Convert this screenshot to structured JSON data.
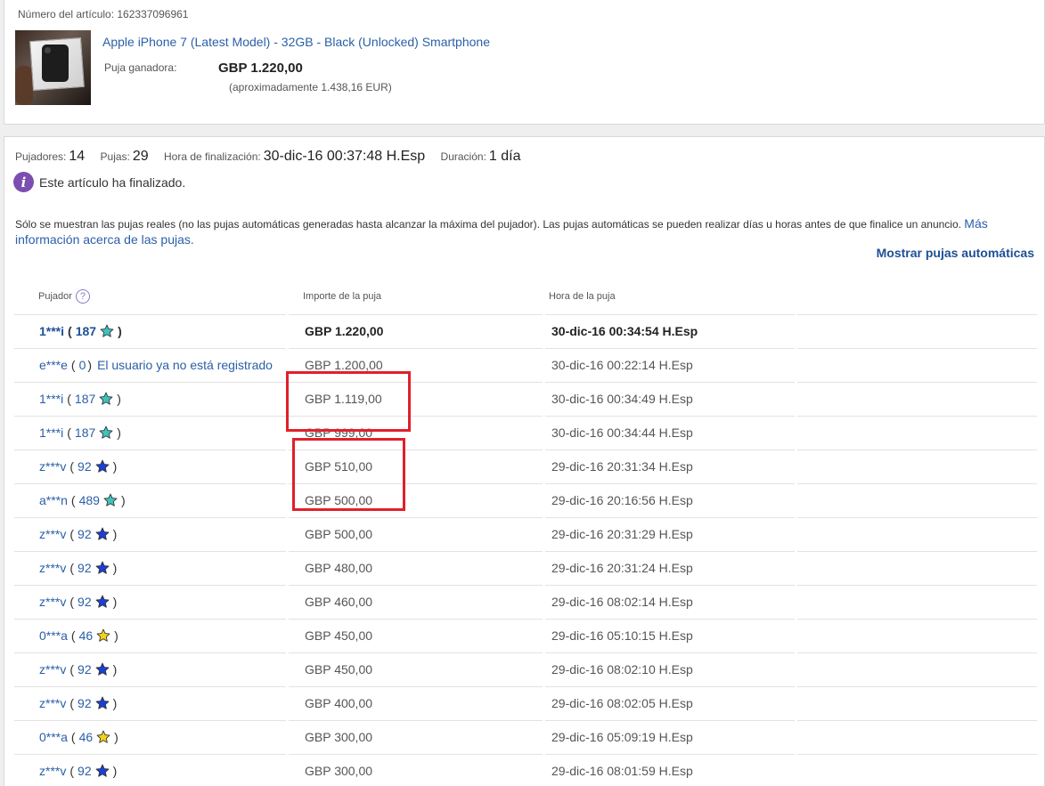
{
  "item": {
    "number_label": "Número del artículo: 162337096961",
    "title": "Apple iPhone 7 (Latest Model) - 32GB - Black (Unlocked) Smartphone",
    "winning_label": "Puja ganadora:",
    "winning_price": "GBP 1.220,00",
    "approx": "(aproximadamente 1.438,16 EUR)"
  },
  "summary": {
    "bidders_label": "Pujadores:",
    "bidders": "14",
    "bids_label": "Pujas:",
    "bids": "29",
    "end_label": "Hora de finalización:",
    "end": "30-dic-16 00:37:48 H.Esp",
    "duration_label": "Duración:",
    "duration": "1 día"
  },
  "notice": "Este artículo ha finalizado.",
  "disclaimer": {
    "text": "Sólo se muestran las pujas reales (no las pujas automáticas generadas hasta alcanzar la máxima del pujador). Las pujas automáticas se pueden realizar días u horas antes de que finalice un anuncio. ",
    "link": "Más información acerca de las pujas."
  },
  "show_auto_bids": "Mostrar pujas automáticas",
  "table": {
    "headers": [
      "Pujador",
      "Importe de la puja",
      "Hora de la puja"
    ],
    "rows": [
      {
        "bidder": "1***i",
        "score": "187",
        "star": "#3cc4c0",
        "amount": "GBP 1.220,00",
        "time": "30-dic-16 00:34:54 H.Esp"
      },
      {
        "bidder": "e***e",
        "score": "0",
        "star": "",
        "note": "El usuario ya no está registrado",
        "amount": "GBP 1.200,00",
        "time": "30-dic-16 00:22:14 H.Esp"
      },
      {
        "bidder": "1***i",
        "score": "187",
        "star": "#3cc4c0",
        "amount": "GBP 1.119,00",
        "time": "30-dic-16 00:34:49 H.Esp"
      },
      {
        "bidder": "1***i",
        "score": "187",
        "star": "#3cc4c0",
        "amount": "GBP 999,00",
        "time": "30-dic-16 00:34:44 H.Esp"
      },
      {
        "bidder": "z***v",
        "score": "92",
        "star": "#1a3fd6",
        "amount": "GBP 510,00",
        "time": "29-dic-16 20:31:34 H.Esp"
      },
      {
        "bidder": "a***n",
        "score": "489",
        "star": "#3cc4c0",
        "amount": "GBP 500,00",
        "time": "29-dic-16 20:16:56 H.Esp"
      },
      {
        "bidder": "z***v",
        "score": "92",
        "star": "#1a3fd6",
        "amount": "GBP 500,00",
        "time": "29-dic-16 20:31:29 H.Esp"
      },
      {
        "bidder": "z***v",
        "score": "92",
        "star": "#1a3fd6",
        "amount": "GBP 480,00",
        "time": "29-dic-16 20:31:24 H.Esp"
      },
      {
        "bidder": "z***v",
        "score": "92",
        "star": "#1a3fd6",
        "amount": "GBP 460,00",
        "time": "29-dic-16 08:02:14 H.Esp"
      },
      {
        "bidder": "0***a",
        "score": "46",
        "star": "#f2d21a",
        "amount": "GBP 450,00",
        "time": "29-dic-16 05:10:15 H.Esp"
      },
      {
        "bidder": "z***v",
        "score": "92",
        "star": "#1a3fd6",
        "amount": "GBP 450,00",
        "time": "29-dic-16 08:02:10 H.Esp"
      },
      {
        "bidder": "z***v",
        "score": "92",
        "star": "#1a3fd6",
        "amount": "GBP 400,00",
        "time": "29-dic-16 08:02:05 H.Esp"
      },
      {
        "bidder": "0***a",
        "score": "46",
        "star": "#f2d21a",
        "amount": "GBP 300,00",
        "time": "29-dic-16 05:09:19 H.Esp"
      },
      {
        "bidder": "z***v",
        "score": "92",
        "star": "#1a3fd6",
        "amount": "GBP 300,00",
        "time": "29-dic-16 08:01:59 H.Esp"
      }
    ]
  },
  "highlight_color": "#e0202a"
}
